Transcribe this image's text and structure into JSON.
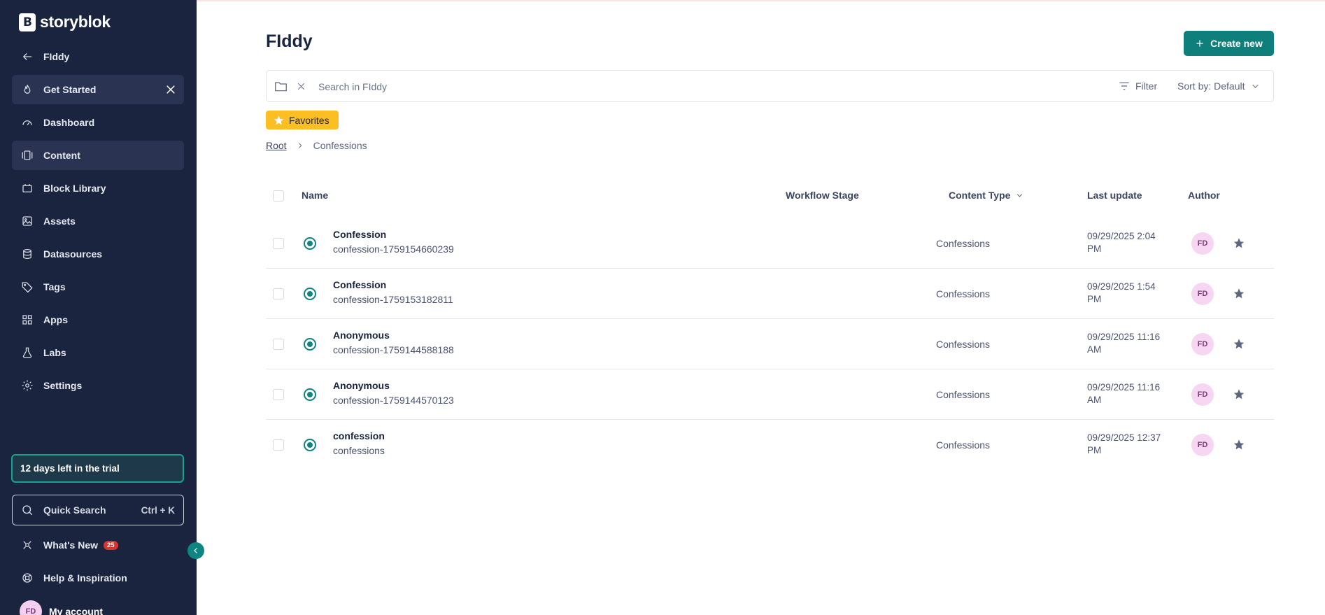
{
  "brand": {
    "name": "storyblok"
  },
  "sidebar": {
    "back_label": "FIddy",
    "items": [
      {
        "label": "Get Started",
        "icon": "flame-icon"
      },
      {
        "label": "Dashboard",
        "icon": "gauge-icon"
      },
      {
        "label": "Content",
        "icon": "content-icon"
      },
      {
        "label": "Block Library",
        "icon": "block-icon"
      },
      {
        "label": "Assets",
        "icon": "image-icon"
      },
      {
        "label": "Datasources",
        "icon": "database-icon"
      },
      {
        "label": "Tags",
        "icon": "tag-icon"
      },
      {
        "label": "Apps",
        "icon": "apps-icon"
      },
      {
        "label": "Labs",
        "icon": "flask-icon"
      },
      {
        "label": "Settings",
        "icon": "gear-icon"
      }
    ],
    "trial_text": "12 days left in the trial",
    "quick_search": {
      "label": "Quick Search",
      "shortcut": "Ctrl + K"
    },
    "whats_new": {
      "label": "What's New",
      "count": "25"
    },
    "help_label": "Help & Inspiration",
    "account": {
      "initials": "FD",
      "label": "My account"
    }
  },
  "main": {
    "title": "FIddy",
    "create_label": "Create new",
    "search": {
      "placeholder": "Search in FIddy",
      "value": ""
    },
    "filter_label": "Filter",
    "sort_label": "Sort by: Default",
    "favorites_label": "Favorites",
    "breadcrumb": {
      "root": "Root",
      "current": "Confessions"
    },
    "columns": {
      "name": "Name",
      "workflow": "Workflow Stage",
      "content_type": "Content Type",
      "last_update": "Last update",
      "author": "Author"
    },
    "rows": [
      {
        "name": "Confession",
        "slug": "confession-1759154660239",
        "content_type": "Confessions",
        "updated_line1": "09/29/2025 2:04",
        "updated_line2": "PM",
        "author": "FD"
      },
      {
        "name": "Confession",
        "slug": "confession-1759153182811",
        "content_type": "Confessions",
        "updated_line1": "09/29/2025 1:54",
        "updated_line2": "PM",
        "author": "FD"
      },
      {
        "name": "Anonymous",
        "slug": "confession-1759144588188",
        "content_type": "Confessions",
        "updated_line1": "09/29/2025 11:16",
        "updated_line2": "AM",
        "author": "FD"
      },
      {
        "name": "Anonymous",
        "slug": "confession-1759144570123",
        "content_type": "Confessions",
        "updated_line1": "09/29/2025 11:16",
        "updated_line2": "AM",
        "author": "FD"
      },
      {
        "name": "confession",
        "slug": "confessions",
        "content_type": "Confessions",
        "updated_line1": "09/29/2025 12:37",
        "updated_line2": "PM",
        "author": "FD"
      }
    ]
  },
  "colors": {
    "sidebar_bg": "#1b243f",
    "accent": "#0e7f7a",
    "favorites": "#fbbf24",
    "badge": "#d9352f"
  }
}
